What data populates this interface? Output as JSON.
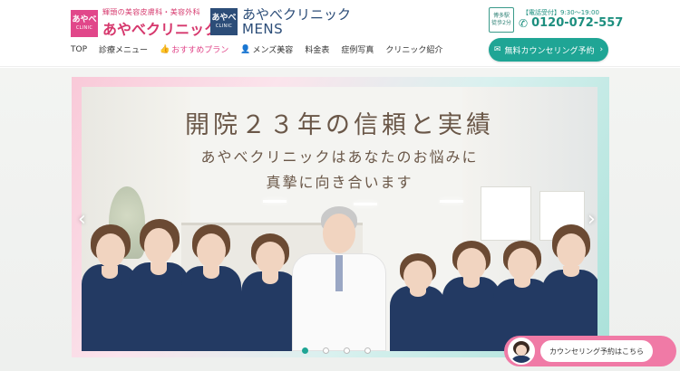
{
  "header": {
    "main_logo": {
      "square_jp": "あやべ",
      "square_en": "CLINIC",
      "tagline": "輝頭の美容皮膚科・美容外科",
      "name": "あやべクリニック"
    },
    "mens_logo": {
      "square_jp": "あやべ",
      "square_en": "CLINIC",
      "name": "あやべクリニック",
      "subname": "MENS"
    },
    "access_badge": {
      "line1": "博多駅",
      "line2": "徒歩2分"
    },
    "phone": {
      "hours": "【電話受付】9:30〜19:00",
      "number": "0120-072-557",
      "icon": "phone-icon"
    },
    "cta": {
      "label": "無料カウンセリング予約",
      "icon": "mail-icon"
    },
    "nav": [
      {
        "label": "TOP"
      },
      {
        "label": "診療メニュー"
      },
      {
        "label": "おすすめプラン",
        "icon": "thumbs-up-icon"
      },
      {
        "label": "メンズ美容",
        "icon": "person-icon"
      },
      {
        "label": "料金表"
      },
      {
        "label": "症例写真"
      },
      {
        "label": "クリニック紹介"
      }
    ]
  },
  "hero": {
    "headline": "開院２３年の信頼と実績",
    "sub_line1": "あやべクリニックはあなたのお悩みに",
    "sub_line2": "真摯に向き合います",
    "slide_count": 4,
    "active_slide": 1
  },
  "floating_cta": {
    "label": "カウンセリング予約はこちら"
  },
  "colors": {
    "brand_pink": "#e1478a",
    "brand_navy": "#2c4d78",
    "accent_teal": "#1fa595",
    "float_pink": "#f07aa6"
  }
}
